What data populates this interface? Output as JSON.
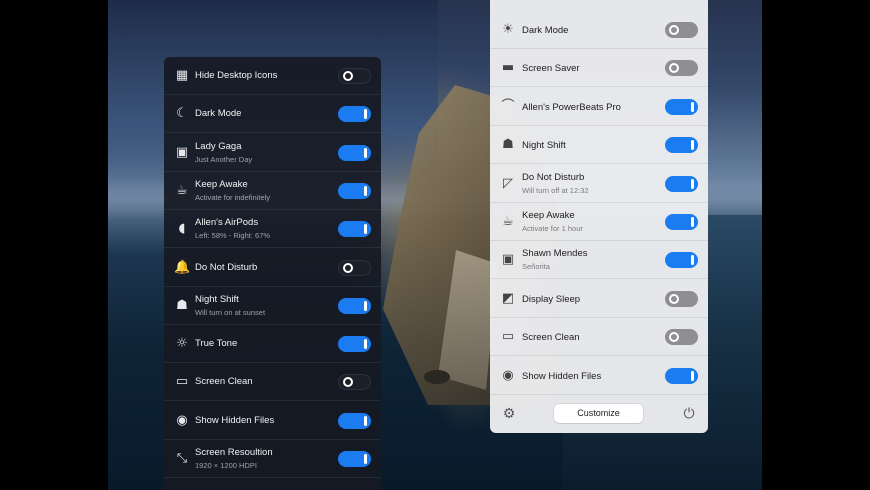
{
  "dark_panel": {
    "items": [
      {
        "title": "Hide Desktop Icons",
        "subtitle": "",
        "icon": "desktop-grid-icon",
        "glyph": "▦",
        "state": "off"
      },
      {
        "title": "Dark Mode",
        "subtitle": "",
        "icon": "moon-icon",
        "glyph": "☾",
        "state": "on"
      },
      {
        "title": "Lady Gaga",
        "subtitle": "Just Another Day",
        "icon": "album-art-icon",
        "glyph": "▣",
        "state": "on"
      },
      {
        "title": "Keep Awake",
        "subtitle": "Activate for indefinitely",
        "icon": "coffee-cup-icon",
        "glyph": "☕",
        "state": "on"
      },
      {
        "title": "Allen's AirPods",
        "subtitle": "Left: 58% - Right: 67%",
        "icon": "airpods-icon",
        "glyph": "◖",
        "state": "on"
      },
      {
        "title": "Do Not Disturb",
        "subtitle": "",
        "icon": "bell-icon",
        "glyph": "🔔",
        "state": "off"
      },
      {
        "title": "Night Shift",
        "subtitle": "Will turn on at sunset",
        "icon": "lamp-icon",
        "glyph": "☗",
        "state": "on"
      },
      {
        "title": "True Tone",
        "subtitle": "",
        "icon": "sun-outline-icon",
        "glyph": "☼",
        "state": "on"
      },
      {
        "title": "Screen Clean",
        "subtitle": "",
        "icon": "screen-clean-icon",
        "glyph": "▭",
        "state": "off"
      },
      {
        "title": "Show Hidden Files",
        "subtitle": "",
        "icon": "hidden-files-icon",
        "glyph": "◉",
        "state": "on"
      },
      {
        "title": "Screen Resoultion",
        "subtitle": "1920 × 1200 HDPI",
        "icon": "screen-resolution-icon",
        "glyph": "⤡",
        "state": "on"
      }
    ]
  },
  "light_panel": {
    "items": [
      {
        "title": "Dark Mode",
        "subtitle": "",
        "icon": "sun-icon",
        "glyph": "☀",
        "state": "off"
      },
      {
        "title": "Screen Saver",
        "subtitle": "",
        "icon": "screen-saver-icon",
        "glyph": "▬",
        "state": "off"
      },
      {
        "title": "Allen's PowerBeats Pro",
        "subtitle": "",
        "icon": "earbuds-icon",
        "glyph": "⌒",
        "state": "on"
      },
      {
        "title": "Night Shift",
        "subtitle": "",
        "icon": "lamp-icon",
        "glyph": "☗",
        "state": "on"
      },
      {
        "title": "Do Not Disturb",
        "subtitle": "Will turn off at 12:32",
        "icon": "do-not-disturb-icon",
        "glyph": "◸",
        "state": "on"
      },
      {
        "title": "Keep Awake",
        "subtitle": "Activate for 1 hour",
        "icon": "coffee-cup-icon",
        "glyph": "☕",
        "state": "on"
      },
      {
        "title": "Shawn Mendes",
        "subtitle": "Señorita",
        "icon": "album-art-icon",
        "glyph": "▣",
        "state": "on"
      },
      {
        "title": "Display Sleep",
        "subtitle": "",
        "icon": "display-sleep-icon",
        "glyph": "◩",
        "state": "off"
      },
      {
        "title": "Screen Clean",
        "subtitle": "",
        "icon": "screen-clean-icon",
        "glyph": "▭",
        "state": "off"
      },
      {
        "title": "Show Hidden Files",
        "subtitle": "",
        "icon": "hidden-files-icon",
        "glyph": "◉",
        "state": "on"
      }
    ],
    "footer": {
      "settings_icon": "gear-icon",
      "settings_glyph": "⚙",
      "customize_label": "Customize",
      "power_icon": "power-icon",
      "power_glyph": "⏻"
    }
  },
  "colors": {
    "toggle_on": "#1a7cf0",
    "dark_panel_bg": "#161a24",
    "light_panel_bg": "#eeeef0"
  }
}
